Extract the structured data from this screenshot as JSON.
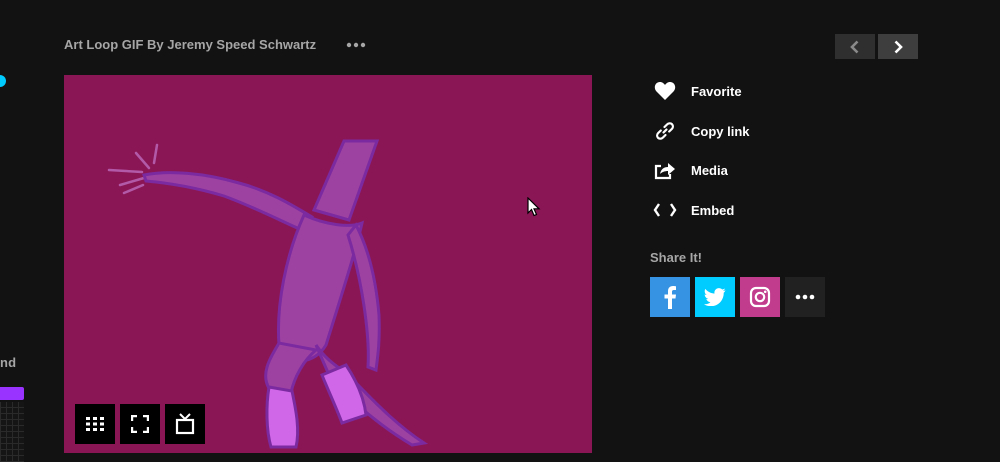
{
  "left_strip": {
    "text": "nd"
  },
  "gif": {
    "title": "Art Loop GIF By Jeremy Speed Schwartz",
    "background_color": "#8b1656",
    "controls": [
      {
        "icon": "grid-icon"
      },
      {
        "icon": "fullscreen-icon"
      },
      {
        "icon": "tv-icon"
      }
    ]
  },
  "pagination": {
    "prev_icon": "chevron-left-icon",
    "next_icon": "chevron-right-icon"
  },
  "actions": [
    {
      "label": "Favorite",
      "icon": "heart-icon"
    },
    {
      "label": "Copy link",
      "icon": "link-icon"
    },
    {
      "label": "Media",
      "icon": "share-arrow-icon"
    },
    {
      "label": "Embed",
      "icon": "code-brackets-icon"
    }
  ],
  "share": {
    "title": "Share It!",
    "networks": [
      {
        "name": "facebook",
        "icon": "facebook-icon",
        "color": "#3693e3"
      },
      {
        "name": "twitter",
        "icon": "twitter-icon",
        "color": "#00ccff"
      },
      {
        "name": "instagram",
        "icon": "instagram-icon",
        "color": "#c23c8d"
      },
      {
        "name": "more",
        "icon": "more-icon",
        "color": "#212121"
      }
    ]
  }
}
